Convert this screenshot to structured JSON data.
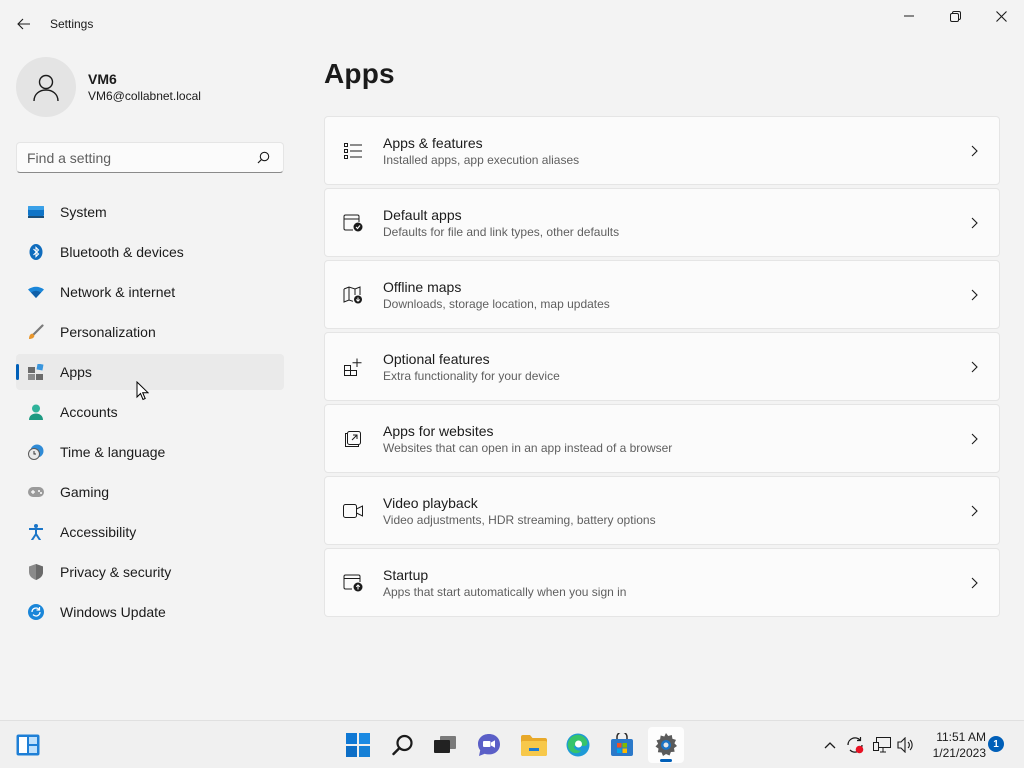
{
  "window": {
    "title": "Settings",
    "buttons": {
      "minimize": "minimize-icon",
      "maximize": "maximize-icon",
      "close": "close-icon"
    }
  },
  "profile": {
    "name": "VM6",
    "email": "VM6@collabnet.local"
  },
  "search": {
    "placeholder": "Find a setting",
    "value": ""
  },
  "sidebar": {
    "items": [
      {
        "label": "System",
        "icon": "system-icon",
        "selected": false
      },
      {
        "label": "Bluetooth & devices",
        "icon": "bluetooth-icon",
        "selected": false
      },
      {
        "label": "Network & internet",
        "icon": "wifi-icon",
        "selected": false
      },
      {
        "label": "Personalization",
        "icon": "brush-icon",
        "selected": false
      },
      {
        "label": "Apps",
        "icon": "apps-icon",
        "selected": true
      },
      {
        "label": "Accounts",
        "icon": "person-icon",
        "selected": false
      },
      {
        "label": "Time & language",
        "icon": "clock-globe-icon",
        "selected": false
      },
      {
        "label": "Gaming",
        "icon": "gamepad-icon",
        "selected": false
      },
      {
        "label": "Accessibility",
        "icon": "accessibility-icon",
        "selected": false
      },
      {
        "label": "Privacy & security",
        "icon": "shield-icon",
        "selected": false
      },
      {
        "label": "Windows Update",
        "icon": "update-icon",
        "selected": false
      }
    ]
  },
  "main": {
    "title": "Apps",
    "cards": [
      {
        "title": "Apps & features",
        "subtitle": "Installed apps, app execution aliases",
        "icon": "list-icon"
      },
      {
        "title": "Default apps",
        "subtitle": "Defaults for file and link types, other defaults",
        "icon": "default-apps-icon"
      },
      {
        "title": "Offline maps",
        "subtitle": "Downloads, storage location, map updates",
        "icon": "map-icon"
      },
      {
        "title": "Optional features",
        "subtitle": "Extra functionality for your device",
        "icon": "add-grid-icon"
      },
      {
        "title": "Apps for websites",
        "subtitle": "Websites that can open in an app instead of a browser",
        "icon": "open-in-app-icon"
      },
      {
        "title": "Video playback",
        "subtitle": "Video adjustments, HDR streaming, battery options",
        "icon": "video-icon"
      },
      {
        "title": "Startup",
        "subtitle": "Apps that start automatically when you sign in",
        "icon": "startup-icon"
      }
    ]
  },
  "taskbar": {
    "clock_time": "11:51 AM",
    "clock_date": "1/21/2023",
    "notification_count": "1"
  },
  "colors": {
    "accent": "#005fb8",
    "background": "#f3f3f3",
    "card": "#fbfbfb"
  }
}
